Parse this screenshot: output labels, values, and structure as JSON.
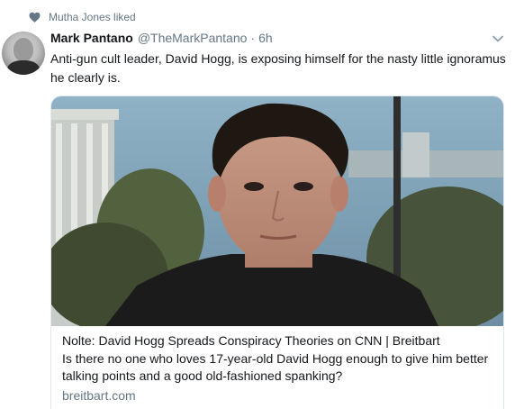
{
  "social_context": {
    "text": "Mutha Jones liked",
    "icon": "heart-icon"
  },
  "tweet": {
    "author_name": "Mark Pantano",
    "author_handle": "@TheMarkPantano",
    "separator": "·",
    "time": "6h",
    "text": "Anti-gun cult leader, David Hogg, is exposing himself for the nasty little ignoramus he clearly is."
  },
  "card": {
    "title": "Nolte: David Hogg Spreads Conspiracy Theories on CNN | Breitbart",
    "description": "Is there no one who loves 17-year-old David Hogg enough to give him better talking points and a good old-fashioned spanking?",
    "domain": "breitbart.com"
  },
  "colors": {
    "text": "#14171a",
    "secondary": "#657786",
    "border": "#e1e8ed"
  }
}
